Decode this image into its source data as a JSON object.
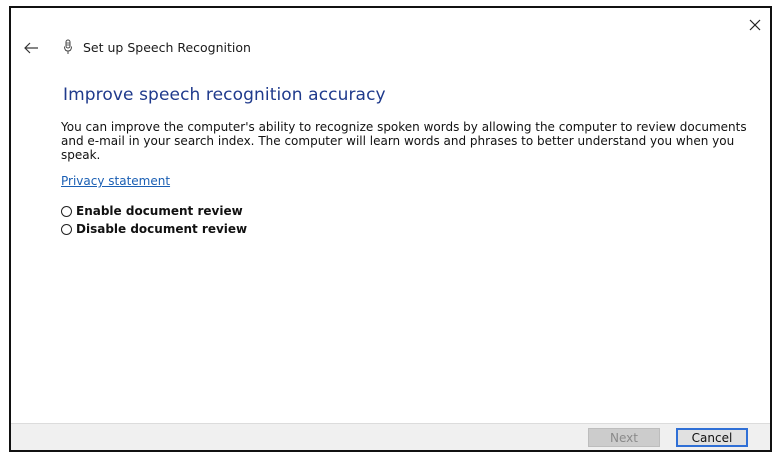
{
  "window": {
    "title": "Set up Speech Recognition"
  },
  "page": {
    "heading": "Improve speech recognition accuracy",
    "description": "You can improve the computer's ability to recognize spoken words by allowing the computer to review documents and e-mail in your search index. The computer will learn words and phrases to better understand you when you speak.",
    "privacy_link": "Privacy statement"
  },
  "options": [
    {
      "label": "Enable document review",
      "selected": false
    },
    {
      "label": "Disable document review",
      "selected": false
    }
  ],
  "footer": {
    "next_label": "Next",
    "cancel_label": "Cancel"
  },
  "colors": {
    "heading": "#1f3a8c",
    "link": "#1a5fb4",
    "focus_border": "#2f6fd6"
  },
  "icons": {
    "close": "close-icon",
    "back": "back-arrow-icon",
    "app": "microphone-icon"
  }
}
